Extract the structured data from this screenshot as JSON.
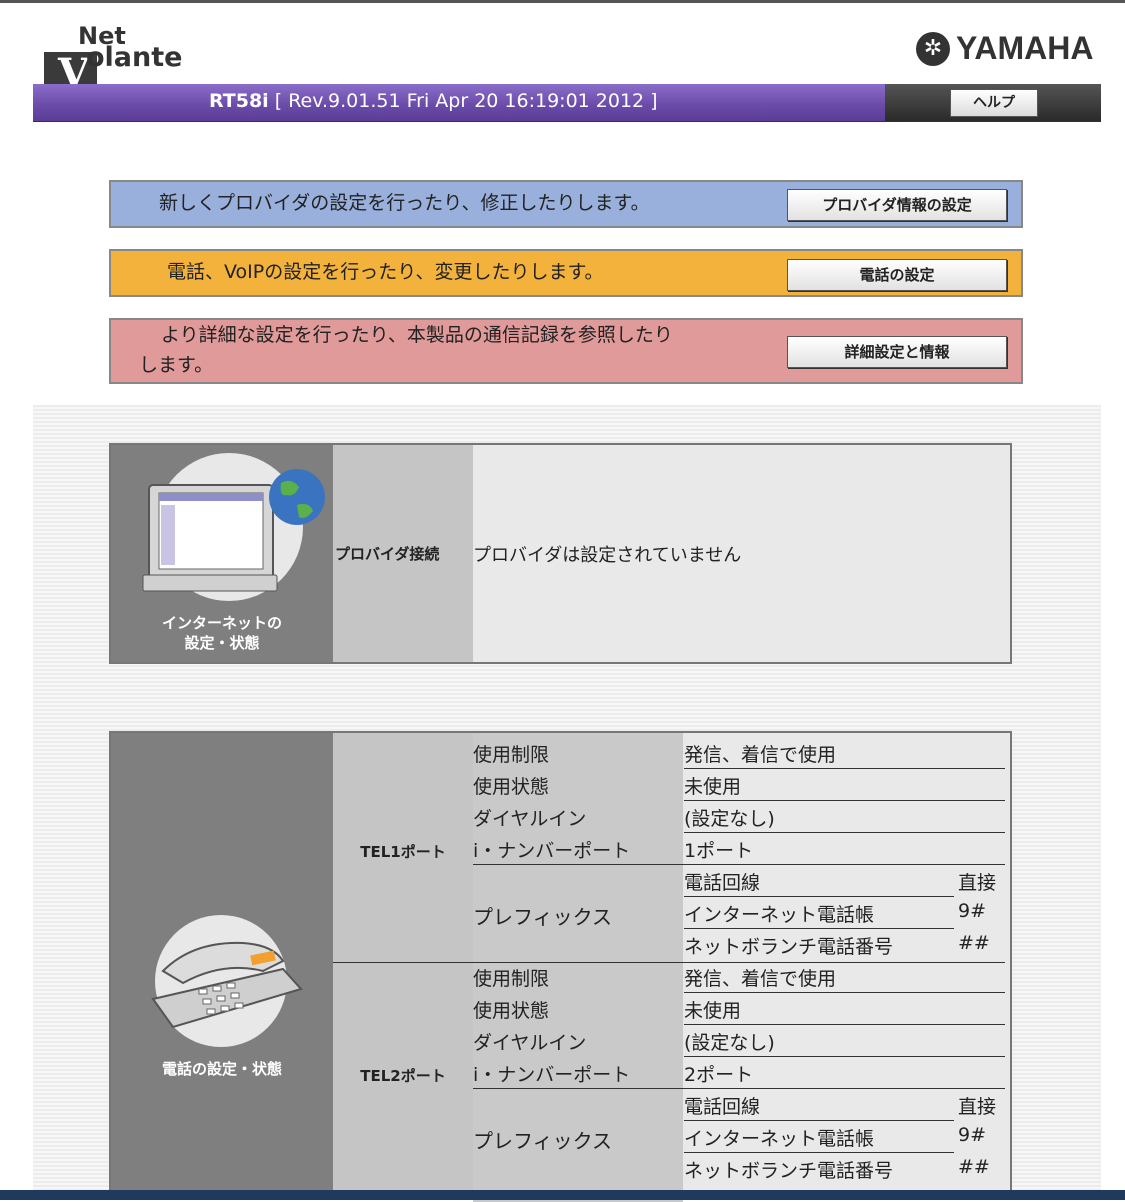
{
  "logo": {
    "net": "Net",
    "volante": "olante",
    "v": "V"
  },
  "brand": {
    "name": "YAMAHA"
  },
  "header": {
    "model": "RT58i",
    "revision": "[ Rev.9.01.51 Fri Apr 20 16:19:01 2012 ]",
    "help": "ヘルプ"
  },
  "actions": [
    {
      "text": "新しくプロバイダの設定を行ったり、修正したりします。",
      "button": "プロバイダ情報の設定",
      "color": "#9ab0dc"
    },
    {
      "text": "電話、VoIPの設定を行ったり、変更したりします。",
      "button": "電話の設定",
      "color": "#f2b23c"
    },
    {
      "text_line1": "より詳細な設定を行ったり、本製品の通信記録を参照したり",
      "text_line2": "します。",
      "button": "詳細設定と情報",
      "color": "#e09a9a"
    }
  ],
  "internet": {
    "side_line1": "インターネットの",
    "side_line2": "設定・状態",
    "label": "プロバイダ接続",
    "value": "プロバイダは設定されていません"
  },
  "phone": {
    "side_label": "電話の設定・状態",
    "ports": [
      {
        "name": "TEL1ポート",
        "rows": [
          {
            "key": "使用制限",
            "value": "発信、着信で使用"
          },
          {
            "key": "使用状態",
            "value": "未使用"
          },
          {
            "key": "ダイヤルイン",
            "value": "(設定なし)"
          },
          {
            "key": "i・ナンバーポート",
            "value": "1ポート"
          }
        ],
        "prefix_label": "プレフィックス",
        "prefix": [
          {
            "key": "電話回線",
            "value": "直接"
          },
          {
            "key": "インターネット電話帳",
            "value": "9#"
          },
          {
            "key": "ネットボランチ電話番号",
            "value": "##"
          }
        ]
      },
      {
        "name": "TEL2ポート",
        "rows": [
          {
            "key": "使用制限",
            "value": "発信、着信で使用"
          },
          {
            "key": "使用状態",
            "value": "未使用"
          },
          {
            "key": "ダイヤルイン",
            "value": "(設定なし)"
          },
          {
            "key": "i・ナンバーポート",
            "value": "2ポート"
          }
        ],
        "prefix_label": "プレフィックス",
        "prefix": [
          {
            "key": "電話回線",
            "value": "直接"
          },
          {
            "key": "インターネット電話帳",
            "value": "9#"
          },
          {
            "key": "ネットボランチ電話番号",
            "value": "##"
          }
        ]
      }
    ]
  }
}
